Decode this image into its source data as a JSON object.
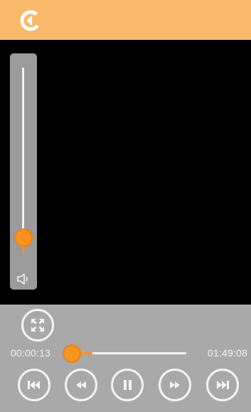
{
  "colors": {
    "topbar": "#F9BA6E",
    "accent": "#F7931E",
    "controls_bg": "#A9A9A9",
    "panel_bg": "#9B9B9B",
    "icon": "#F4F4F4"
  },
  "topbar": {
    "back_icon": "back-arrow-icon"
  },
  "volume": {
    "level_percent": 8,
    "icon": "speaker-icon"
  },
  "playback": {
    "current_time": "00:00:13",
    "total_time": "01:49:08",
    "progress_percent": 1
  },
  "controls": {
    "fullscreen_icon": "fullscreen-icon",
    "buttons": [
      {
        "name": "previous",
        "icon": "skip-previous-icon"
      },
      {
        "name": "rewind",
        "icon": "rewind-icon"
      },
      {
        "name": "pause",
        "icon": "pause-icon"
      },
      {
        "name": "fast-forward",
        "icon": "fast-forward-icon"
      },
      {
        "name": "next",
        "icon": "skip-next-icon"
      }
    ]
  }
}
